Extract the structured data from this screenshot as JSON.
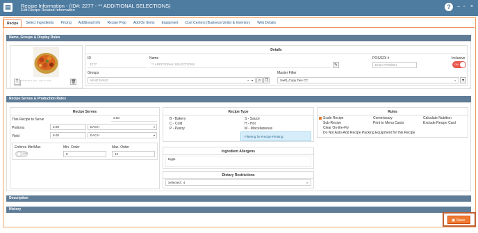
{
  "titlebar": {
    "title": "Recipe Information - (ID#: 2277 - ** ADDITIONAL SELECTIONS)",
    "subtitle": "Edit Recipe Related Information",
    "help": "?",
    "minimize": "–",
    "maximize": "▫",
    "close": "×"
  },
  "tabs": [
    "Recipe",
    "Select Ingredients",
    "Pricing",
    "Additional Info",
    "Recipe Prep",
    "Add On Items",
    "Equipment",
    "Cost Centers (Business Units) & Inventory",
    "Web Details"
  ],
  "section1": {
    "header": "Name, Groups & Display Rules",
    "image_caption": "xxxxxxx x xxx · xxx xx xxx",
    "details_title": "Details",
    "id_label": "ID",
    "id_value": "2277",
    "name_label": "Name",
    "name_value": "** ADDITIONAL SELECTIONS",
    "pos_label": "POS/EDI #",
    "pos_placeholder": "Enter POS/EDI",
    "inclusive_label": "Inclusive",
    "toggle_text": "ON",
    "groups_label": "Groups",
    "groups_value": "WHIZ BANG",
    "master_filter_label": "Master Filter",
    "master_filter_value": "Swift_Copy Dev CC"
  },
  "section2": {
    "header": "Recipe Serves & Production Rules",
    "serves_title": "Recipe Serves",
    "serve_label": "This Recipe to Serve",
    "serve_value": "3.00",
    "portions_label": "Portions",
    "portions_value": "3.00",
    "portions_unit": "EACH",
    "yield_label": "Yield",
    "yield_value": "9.00",
    "yield_unit": "EACH",
    "enforce_label": "Enforce Min/Max",
    "toggle_off": "OFF",
    "min_label": "Min. Order",
    "min_value": "5",
    "max_label": "Max. Order",
    "max_value": "12",
    "type_title": "Recipe Type",
    "types_left": [
      "B - Bakery",
      "C - Cold",
      "P - Pastry"
    ],
    "types_right": [
      "S - Sauce",
      "H - Hot",
      "M - Miscellaneous"
    ],
    "filter_note": "Filtering for Recipe Printing.",
    "allergens_title": "Ingredient Allergens",
    "allergens_value": "Eggs",
    "dietary_title": "Dietary Restrictions",
    "dietary_value": "Selected : 4",
    "rules_title": "Rules",
    "rules_col1": [
      "Scale Recipe",
      "Sub-Recipe",
      "Clear On-the-Fly",
      "Do Not Auto-Add Recipe Packing Equipment for this Recipe"
    ],
    "rules_col2": [
      "Commissary",
      "Print to Menu Cards"
    ],
    "rules_col3": [
      "Calculate Nutrition",
      "Exclude Recipe Card"
    ]
  },
  "section3": {
    "header": "Description"
  },
  "section4": {
    "header": "History"
  },
  "save": {
    "label": "Save"
  },
  "colors": {
    "header": "#607d98",
    "titlebar": "#4e7ba0",
    "accent": "#f07830",
    "toggle_on": "#e8574c"
  }
}
